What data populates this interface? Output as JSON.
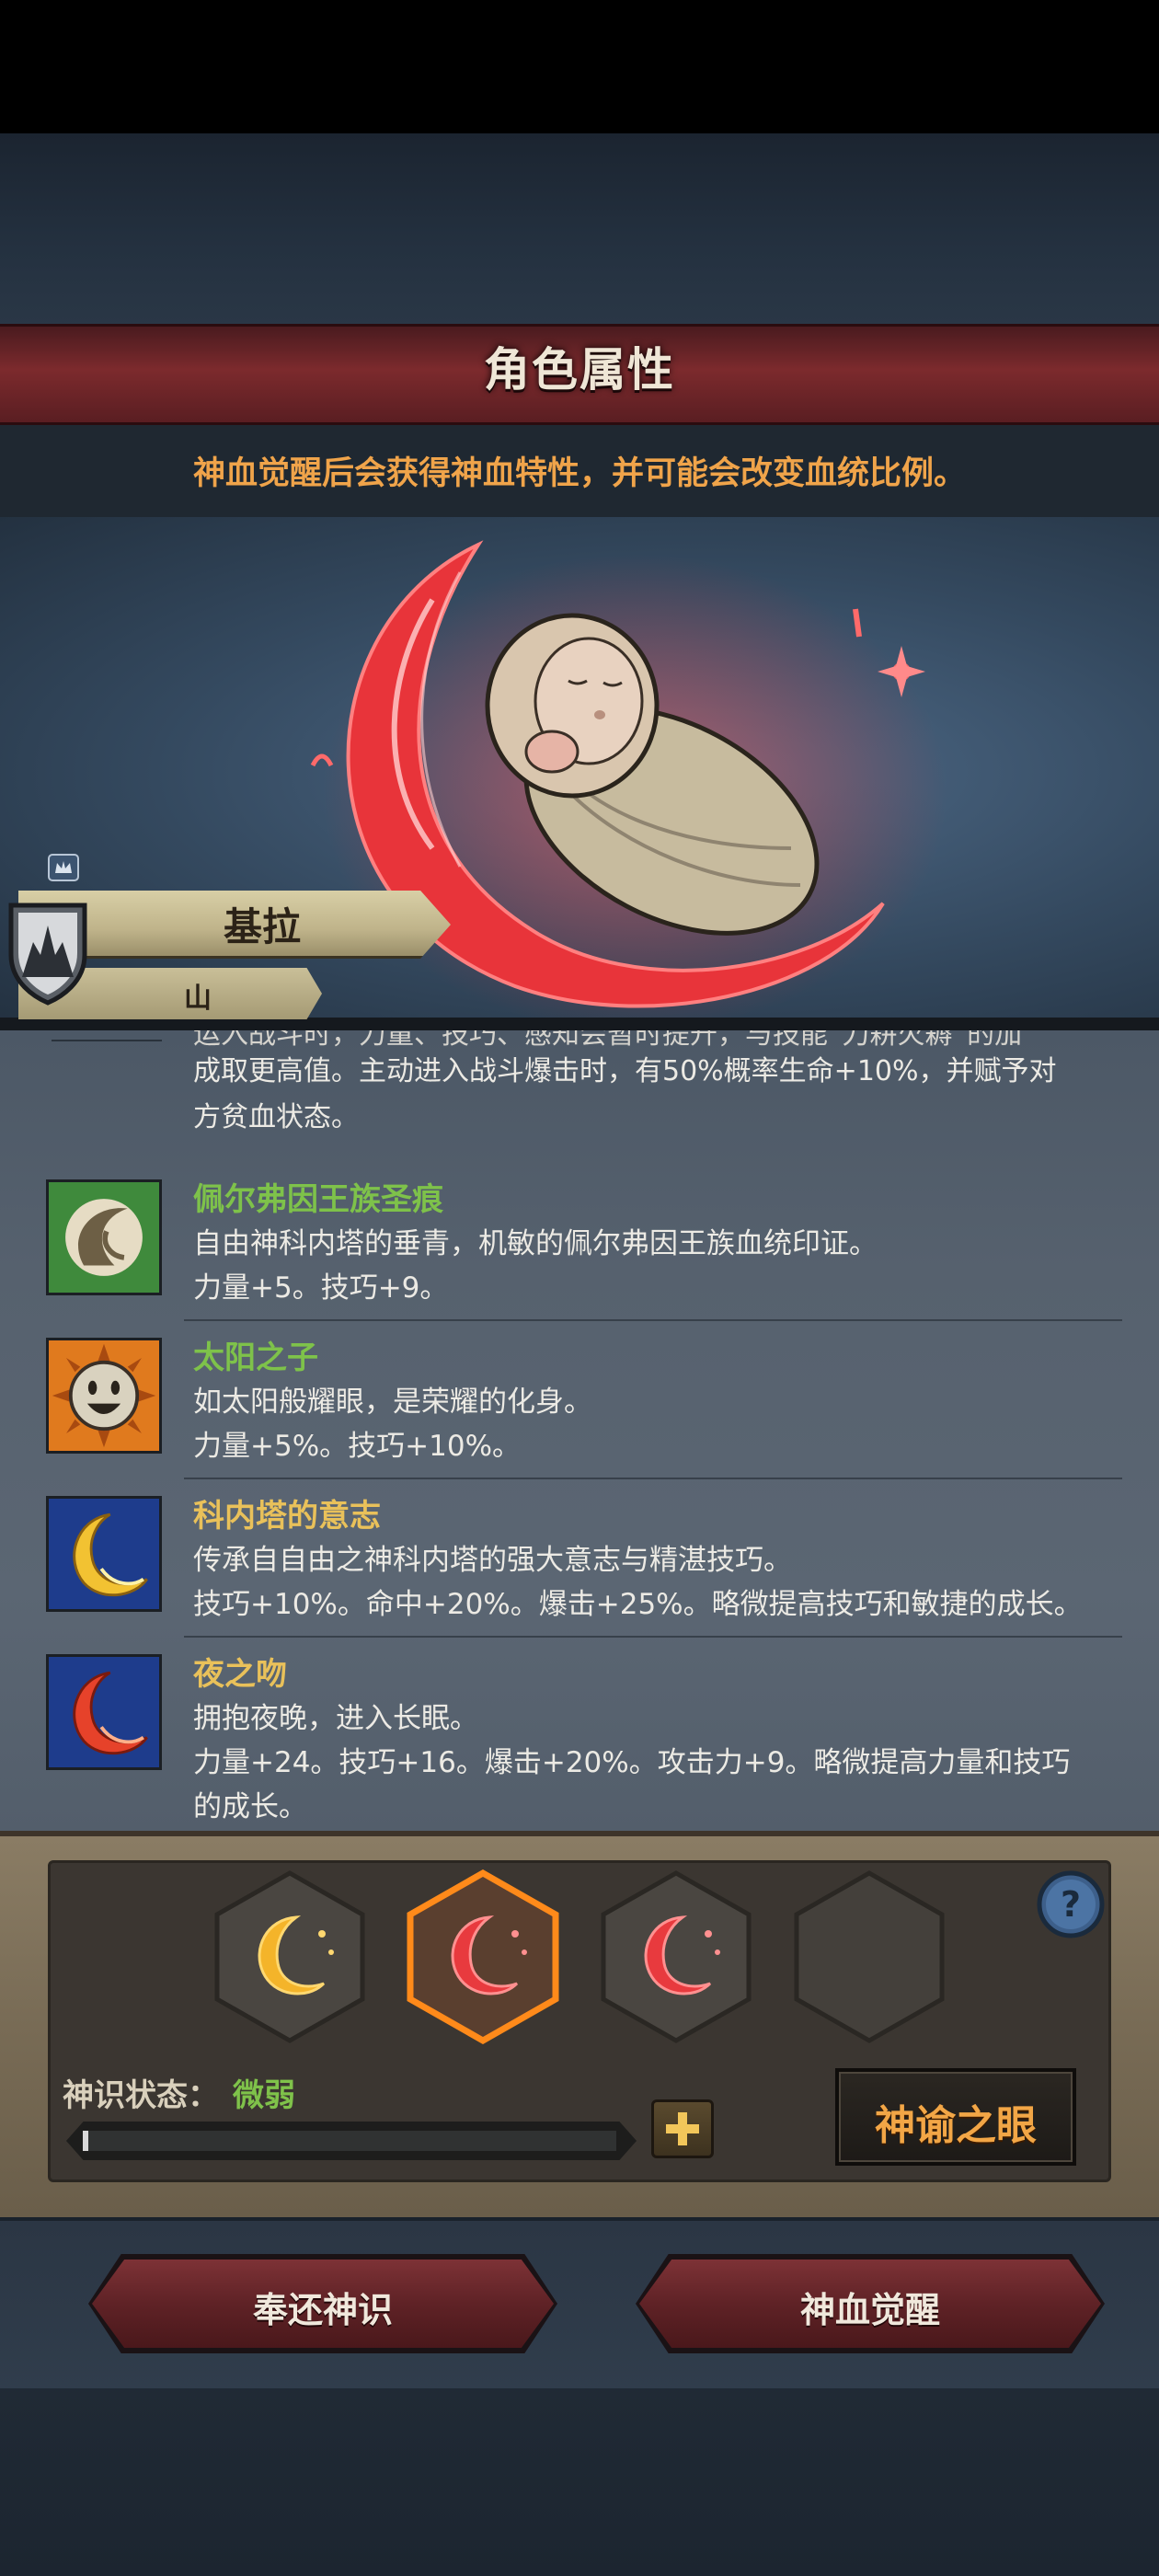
{
  "header": {
    "title": "角色属性",
    "notice": "神血觉醒后会获得神血特性，并可能会改变血统比例。"
  },
  "character": {
    "name": "基拉",
    "lineage": "山"
  },
  "traits_partial": {
    "cut_line": "运入战斗时，力量、技巧、感知会暂时提升，与技能“刀耕火耨”的加",
    "lines": [
      "成取更高值。主动进入战斗爆击时，有50%概率生命+10%，并赋予对",
      "方贫血状态。"
    ]
  },
  "traits": [
    {
      "name": "佩尔弗因王族圣痕",
      "name_color": "#7ec24a",
      "icon": "royal-stigmata-icon",
      "lines": [
        "自由神科内塔的垂青，机敏的佩尔弗因王族血统印证。",
        "力量+5。技巧+9。"
      ]
    },
    {
      "name": "太阳之子",
      "name_color": "#7ec24a",
      "icon": "sun-face-icon",
      "lines": [
        "如太阳般耀眼，是荣耀的化身。",
        "力量+5%。技巧+10%。"
      ]
    },
    {
      "name": "科内塔的意志",
      "name_color": "#e9c15a",
      "icon": "golden-crescent-icon",
      "lines": [
        "传承自自由之神科内塔的强大意志与精湛技巧。",
        "技巧+10%。命中+20%。爆击+25%。略微提高技巧和敏捷的成长。"
      ]
    },
    {
      "name": "夜之吻",
      "name_color": "#e9c15a",
      "icon": "red-crescent-icon",
      "lines": [
        "拥抱夜晚，进入长眠。",
        "力量+24。技巧+16。爆击+20%。攻击力+9。略微提高力量和技巧",
        "的成长。"
      ]
    }
  ],
  "panel": {
    "slots": [
      {
        "icon": "golden-crescent-slot-icon",
        "state": "filled"
      },
      {
        "icon": "red-crescent-slot-icon",
        "state": "selected"
      },
      {
        "icon": "red-crescent-slot-icon",
        "state": "filled"
      },
      {
        "icon": "empty-slot",
        "state": "empty"
      }
    ],
    "status_label": "神识状态：",
    "status_value": "微弱",
    "progress_fraction": 0.01,
    "oracle_button": "神谕之眼"
  },
  "actions": {
    "return_button": "奉还神识",
    "awaken_button": "神血觉醒"
  },
  "colors": {
    "accent_orange": "#f0a44a",
    "green_text": "#7ec24a",
    "gold_text": "#e9c15a",
    "crimson": "#7d3236"
  }
}
